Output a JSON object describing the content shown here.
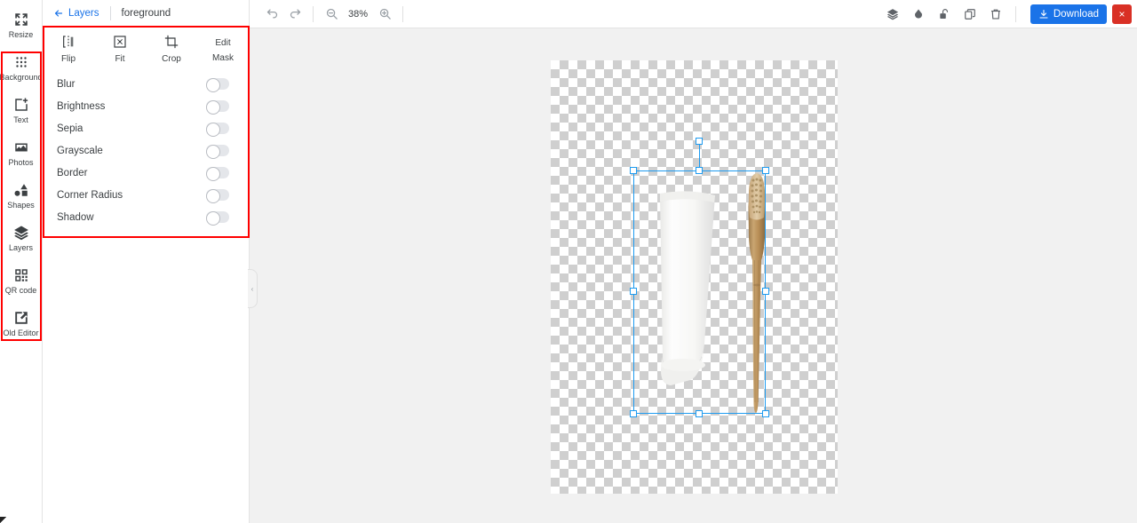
{
  "sidebar": {
    "items": [
      {
        "label": "Resize",
        "icon": "resize-icon"
      },
      {
        "label": "Background",
        "icon": "background-grid-icon"
      },
      {
        "label": "Text",
        "icon": "text-add-icon"
      },
      {
        "label": "Photos",
        "icon": "photos-icon"
      },
      {
        "label": "Shapes",
        "icon": "shapes-icon"
      },
      {
        "label": "Layers",
        "icon": "layers-icon"
      },
      {
        "label": "QR code",
        "icon": "qr-code-icon"
      },
      {
        "label": "Old Editor",
        "icon": "edit-square-icon"
      }
    ]
  },
  "panel": {
    "breadcrumb": {
      "back_label": "Layers",
      "current": "foreground"
    },
    "tools": [
      {
        "label": "Flip",
        "icon": "flip-horizontal-icon"
      },
      {
        "label": "Fit",
        "icon": "fit-to-frame-icon"
      },
      {
        "label": "Crop",
        "icon": "crop-icon"
      },
      {
        "label": "Edit\nMask",
        "icon": "edit-mask-icon"
      }
    ],
    "tools_edit_mask_line1": "Edit",
    "tools_edit_mask_line2": "Mask",
    "filters": [
      {
        "label": "Blur",
        "enabled": "off"
      },
      {
        "label": "Brightness",
        "enabled": "off"
      },
      {
        "label": "Sepia",
        "enabled": "off"
      },
      {
        "label": "Grayscale",
        "enabled": "off"
      },
      {
        "label": "Border",
        "enabled": "off"
      },
      {
        "label": "Corner Radius",
        "enabled": "off"
      },
      {
        "label": "Shadow",
        "enabled": "off"
      }
    ],
    "collapse_glyph": "‹"
  },
  "toolbar": {
    "undo": "undo-icon",
    "redo": "redo-icon",
    "zoom_out": "zoom-out-icon",
    "zoom_level": "38%",
    "zoom_in": "zoom-in-icon",
    "right_icons": [
      {
        "name": "layers-icon"
      },
      {
        "name": "opacity-droplet-icon"
      },
      {
        "name": "unlock-icon"
      },
      {
        "name": "duplicate-icon"
      },
      {
        "name": "delete-trash-icon"
      }
    ],
    "download_label": "Download",
    "close_label": "×"
  },
  "colors": {
    "accent_blue": "#1a73e8",
    "selection_blue": "#1e9bf0",
    "close_red": "#d93025",
    "annotation_red": "#ff0000",
    "canvas_bg": "#f1f1f1"
  },
  "canvas": {
    "artboard_label": "transparent-checkerboard",
    "objects": [
      {
        "name": "toothpaste-tube",
        "selected": "true"
      },
      {
        "name": "bamboo-toothbrush",
        "selected": "true"
      }
    ]
  }
}
